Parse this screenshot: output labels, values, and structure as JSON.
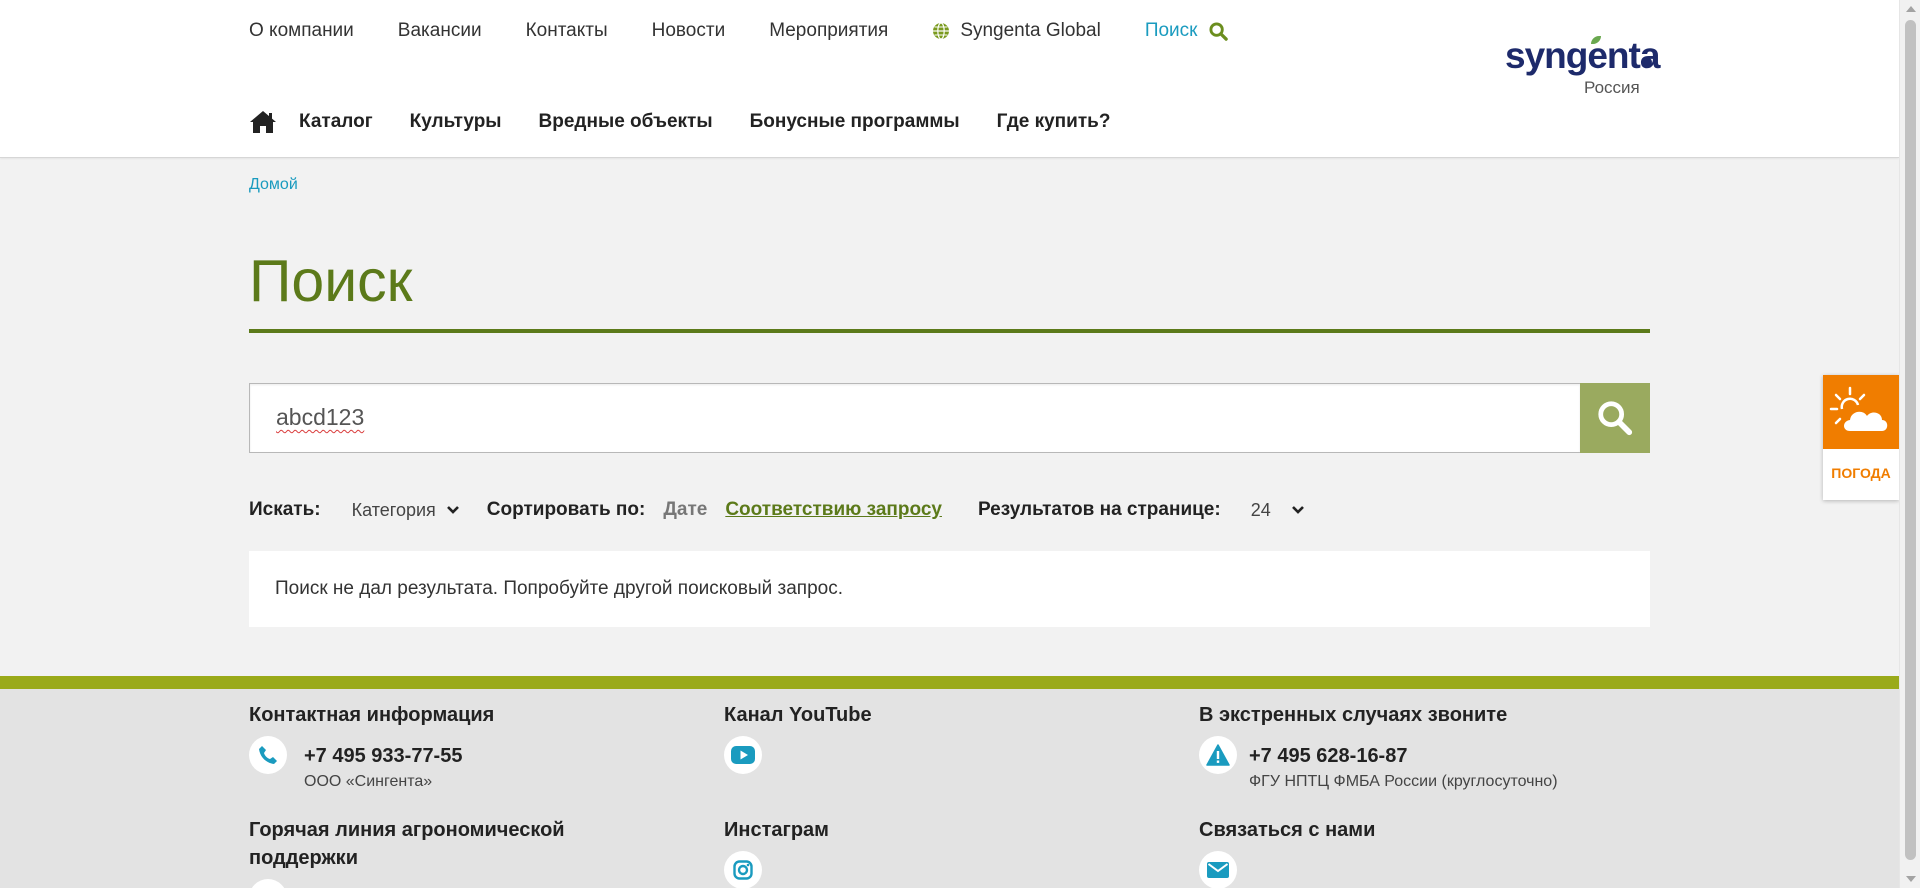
{
  "topnav": {
    "items": [
      "О компании",
      "Вакансии",
      "Контакты",
      "Новости",
      "Мероприятия"
    ],
    "global_label": "Syngenta Global",
    "search_label": "Поиск"
  },
  "logo": {
    "word": "syngenta",
    "country": "Россия"
  },
  "mainnav": {
    "items": [
      "Каталог",
      "Культуры",
      "Вредные объекты",
      "Бонусные программы",
      "Где купить?"
    ]
  },
  "breadcrumb": {
    "home": "Домой"
  },
  "page": {
    "title": "Поиск"
  },
  "search": {
    "value": "abcd123"
  },
  "filters": {
    "search_in_label": "Искать:",
    "category_value": "Категория",
    "sort_label": "Сортировать по:",
    "sort_date": "Дате",
    "sort_relevance": "Соответствию запросу",
    "per_page_label": "Результатов на странице:",
    "per_page_value": "24"
  },
  "results": {
    "empty_message": "Поиск не дал результата. Попробуйте другой поисковый запрос."
  },
  "weather": {
    "label": "ПОГОДА"
  },
  "footer": {
    "contact": {
      "heading": "Контактная информация",
      "phone": "+7 495 933-77-55",
      "company": "ООО «Сингента»"
    },
    "youtube": {
      "heading": "Канал YouTube"
    },
    "emergency": {
      "heading": "В экстренных случаях звоните",
      "phone": "+7 495 628-16-87",
      "org": "ФГУ НПТЦ ФМБА России (круглосуточно)"
    },
    "hotline": {
      "heading": "Горячая линия агрономической поддержки"
    },
    "instagram": {
      "heading": "Инстаграм"
    },
    "contact_us": {
      "heading": "Связаться с нами"
    }
  },
  "colors": {
    "brand_green": "#5c7a1a",
    "link_blue": "#1a9bbf",
    "search_button": "#9aaa5f",
    "weather_orange": "#f07d00",
    "footer_stripe": "#9aaa1a",
    "icon_teal": "#1a9bbf"
  }
}
